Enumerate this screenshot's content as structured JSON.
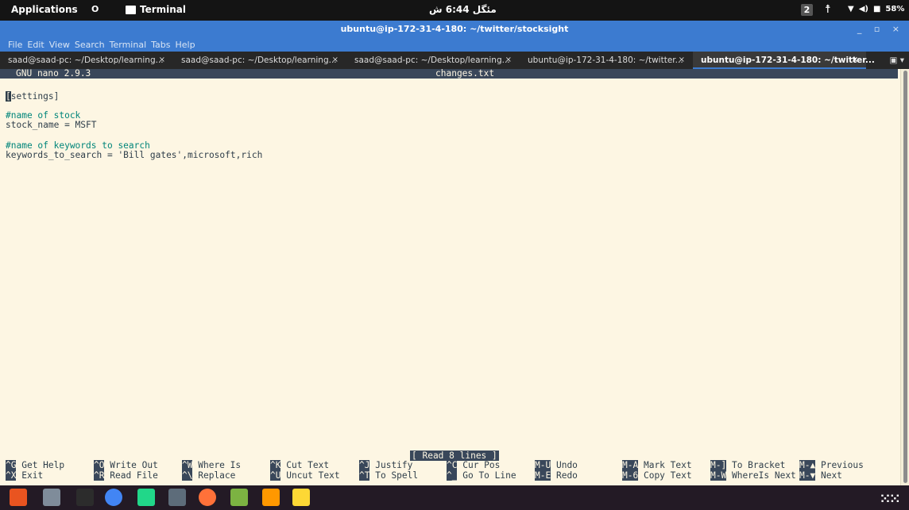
{
  "topbar": {
    "applications": "Applications",
    "circle_glyph": "O",
    "terminal_app": "Terminal",
    "clock": "مئگل 6:44 ش",
    "workspace": "2",
    "battery": "58%"
  },
  "window": {
    "title": "ubuntu@ip-172-31-4-180: ~/twitter/stocksight",
    "controls": "_ ▫ ×"
  },
  "menu": [
    "File",
    "Edit",
    "View",
    "Search",
    "Terminal",
    "Tabs",
    "Help"
  ],
  "tabs": [
    {
      "label": "saad@saad-pc: ~/Desktop/learning...",
      "active": false
    },
    {
      "label": "saad@saad-pc: ~/Desktop/learning...",
      "active": false
    },
    {
      "label": "saad@saad-pc: ~/Desktop/learning...",
      "active": false
    },
    {
      "label": "ubuntu@ip-172-31-4-180: ~/twitter...",
      "active": false
    },
    {
      "label": "ubuntu@ip-172-31-4-180: ~/twitter...",
      "active": true
    }
  ],
  "tab_close": "×",
  "nano": {
    "version": "GNU nano 2.9.3",
    "filename": "changes.txt",
    "cursor_char": "[",
    "lines": {
      "l1_rest": "settings]",
      "l3": "#name of stock",
      "l4": "stock_name = MSFT",
      "l6": "#name of keywords to search",
      "l7": "keywords_to_search = 'Bill gates',microsoft,rich"
    },
    "status": "[ Read 8 lines ]",
    "shortcuts": {
      "row1": [
        {
          "key": "^G",
          "label": "Get Help"
        },
        {
          "key": "^O",
          "label": "Write Out"
        },
        {
          "key": "^W",
          "label": "Where Is"
        },
        {
          "key": "^K",
          "label": "Cut Text"
        },
        {
          "key": "^J",
          "label": "Justify"
        },
        {
          "key": "^C",
          "label": "Cur Pos"
        },
        {
          "key": "M-U",
          "label": "Undo"
        },
        {
          "key": "M-A",
          "label": "Mark Text"
        },
        {
          "key": "M-]",
          "label": "To Bracket"
        },
        {
          "key": "M-▲",
          "label": "Previous"
        }
      ],
      "row2": [
        {
          "key": "^X",
          "label": "Exit"
        },
        {
          "key": "^R",
          "label": "Read File"
        },
        {
          "key": "^\\",
          "label": "Replace"
        },
        {
          "key": "^U",
          "label": "Uncut Text"
        },
        {
          "key": "^T",
          "label": "To Spell"
        },
        {
          "key": "^_",
          "label": "Go To Line"
        },
        {
          "key": "M-E",
          "label": "Redo"
        },
        {
          "key": "M-6",
          "label": "Copy Text"
        },
        {
          "key": "M-W",
          "label": "WhereIs Next"
        },
        {
          "key": "M-▼",
          "label": "Next"
        }
      ]
    }
  },
  "dock": [
    {
      "name": "files-icon",
      "color": "#e95420"
    },
    {
      "name": "drive-icon",
      "color": "#7f8c9a"
    },
    {
      "name": "terminal-icon",
      "color": "#2c2c2c"
    },
    {
      "name": "chrome-icon",
      "color": "#4285f4"
    },
    {
      "name": "pycharm-icon",
      "color": "#21d789"
    },
    {
      "name": "vm-icon",
      "color": "#5d6c7a"
    },
    {
      "name": "firefox-icon",
      "color": "#ff7139"
    },
    {
      "name": "image-viewer-icon",
      "color": "#7cb342"
    },
    {
      "name": "sublime-icon",
      "color": "#ff9800"
    },
    {
      "name": "notes-icon",
      "color": "#fdd835"
    }
  ]
}
